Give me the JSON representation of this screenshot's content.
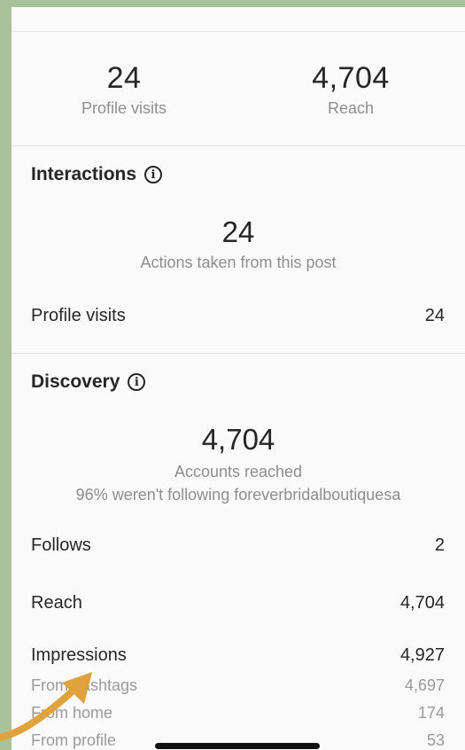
{
  "summary": {
    "profile_visits_value": "24",
    "profile_visits_label": "Profile visits",
    "reach_value": "4,704",
    "reach_label": "Reach"
  },
  "interactions": {
    "title": "Interactions",
    "total": "24",
    "total_label": "Actions taken from this post",
    "rows": [
      {
        "label": "Profile visits",
        "value": "24"
      }
    ]
  },
  "discovery": {
    "title": "Discovery",
    "total": "4,704",
    "total_label": "Accounts reached",
    "note": "96% weren't following foreverbridalboutiquesa",
    "rows": [
      {
        "label": "Follows",
        "value": "2"
      },
      {
        "label": "Reach",
        "value": "4,704"
      },
      {
        "label": "Impressions",
        "value": "4,927"
      }
    ],
    "sub_rows": [
      {
        "label": "From hashtags",
        "value": "4,697"
      },
      {
        "label": "From home",
        "value": "174"
      },
      {
        "label": "From profile",
        "value": "53"
      }
    ]
  },
  "icons": {
    "info": "info-icon",
    "annotation": "arrow-icon"
  },
  "colors": {
    "background": "#a8c39b",
    "arrow": "#e0a23c"
  }
}
